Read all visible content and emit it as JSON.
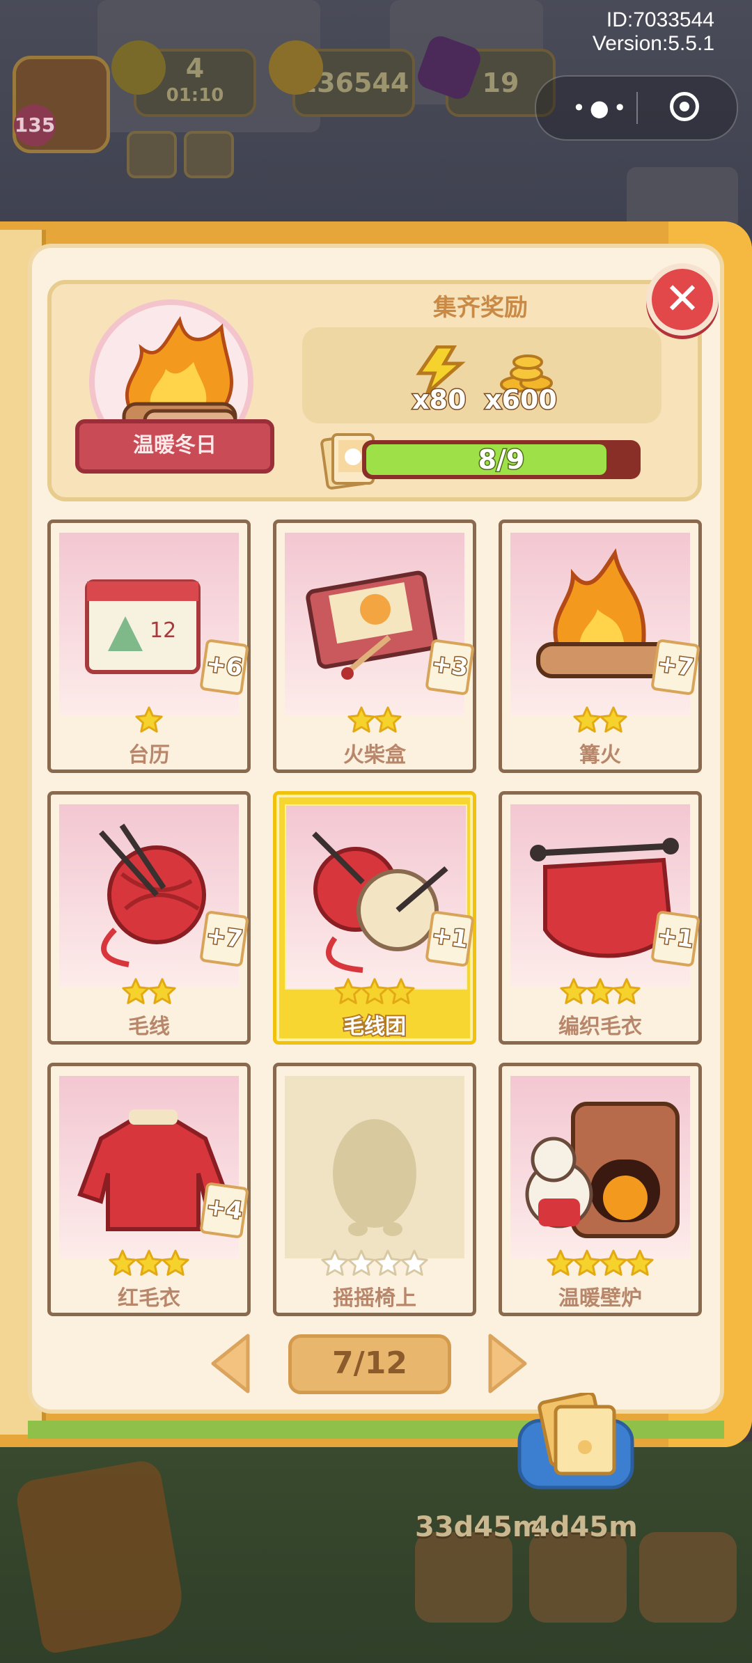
{
  "status": {
    "id_line": "ID:7033544",
    "version_line": "Version:5.5.1"
  },
  "hud": {
    "level": "135",
    "energy": "4",
    "energy_timer": "01:10",
    "coins": "136544",
    "gems": "19",
    "capsule_menu_icon": "more-dots-icon",
    "capsule_target_icon": "target-icon"
  },
  "set": {
    "name": "温暖冬日",
    "reward_title": "集齐奖励",
    "rewards": [
      {
        "icon": "energy-bolt-icon",
        "amount": "x80"
      },
      {
        "icon": "coin-stack-icon",
        "amount": "x600"
      }
    ],
    "progress_label": "8/9",
    "progress_value": 0.889
  },
  "cards": [
    {
      "name": "台历",
      "stars": 1,
      "max_stars": 1,
      "badge": "+6",
      "icon": "desk-calendar-icon",
      "state": "owned"
    },
    {
      "name": "火柴盒",
      "stars": 2,
      "max_stars": 2,
      "badge": "+3",
      "icon": "matchbox-icon",
      "state": "owned"
    },
    {
      "name": "篝火",
      "stars": 2,
      "max_stars": 2,
      "badge": "+7",
      "icon": "bonfire-icon",
      "state": "owned"
    },
    {
      "name": "毛线",
      "stars": 2,
      "max_stars": 2,
      "badge": "+7",
      "icon": "yarn-ball-icon",
      "state": "owned"
    },
    {
      "name": "毛线团",
      "stars": 3,
      "max_stars": 3,
      "badge": "+1",
      "icon": "yarn-bundle-icon",
      "state": "gold"
    },
    {
      "name": "编织毛衣",
      "stars": 3,
      "max_stars": 3,
      "badge": "+1",
      "icon": "knitting-icon",
      "state": "owned"
    },
    {
      "name": "红毛衣",
      "stars": 3,
      "max_stars": 3,
      "badge": "+4",
      "icon": "red-sweater-icon",
      "state": "owned"
    },
    {
      "name": "摇摇椅上",
      "stars": 0,
      "max_stars": 4,
      "badge": "",
      "icon": "locked-silhouette-icon",
      "state": "locked"
    },
    {
      "name": "温暖壁炉",
      "stars": 4,
      "max_stars": 4,
      "badge": "",
      "icon": "fireplace-icon",
      "state": "owned"
    }
  ],
  "pager": {
    "label": "7/12"
  },
  "bottom": {
    "timer_left": "33d45m",
    "timer_right": "4d45m"
  },
  "colors": {
    "accent_gold": "#f7d632",
    "close_red": "#e2474a",
    "progress_green": "#9de048",
    "star_yellow": "#f6d22c"
  }
}
